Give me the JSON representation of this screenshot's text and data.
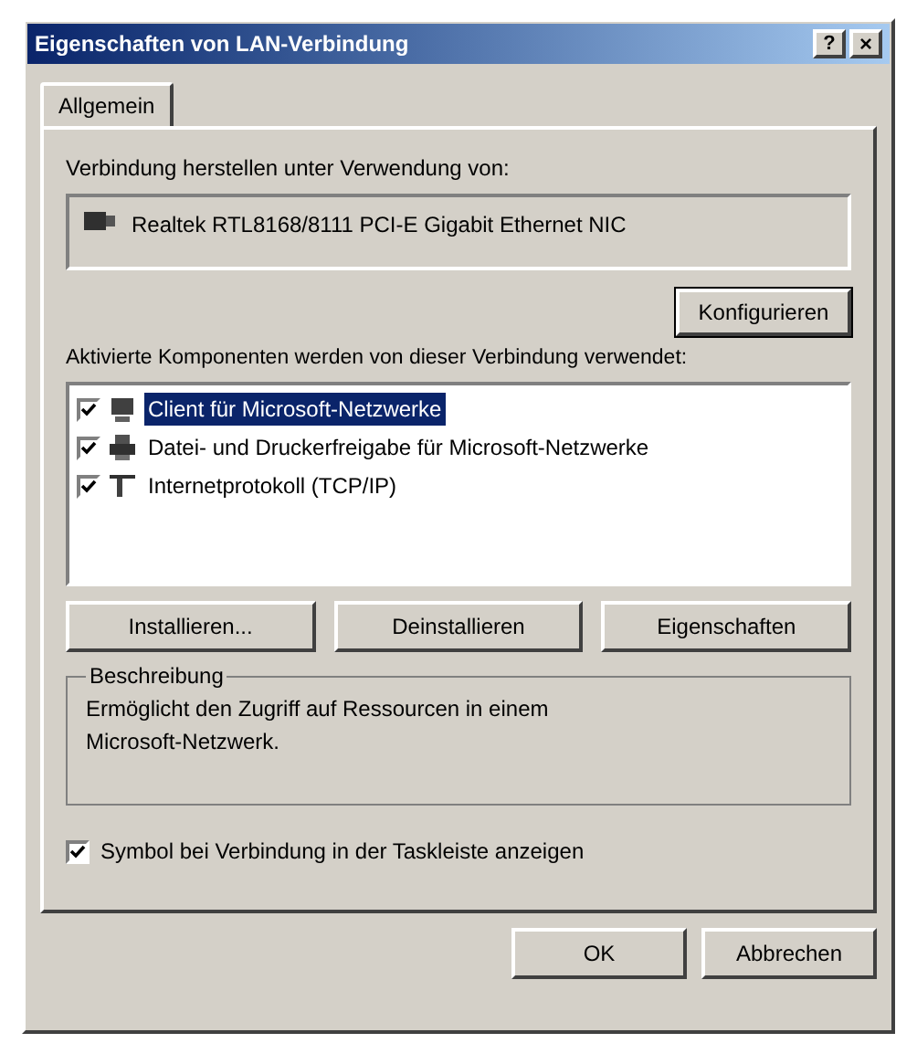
{
  "window": {
    "title": "Eigenschaften von LAN-Verbindung",
    "help_button": "?",
    "close_button": "×"
  },
  "tabs": [
    {
      "label": "Allgemein",
      "selected": true
    }
  ],
  "connect_using": {
    "label": "Verbindung herstellen unter Verwendung von:",
    "adapter": "Realtek RTL8168/8111 PCI-E Gigabit Ethernet NIC",
    "configure_button": "Konfigurieren"
  },
  "components": {
    "label": "Aktivierte Komponenten werden von dieser Verbindung verwendet:",
    "items": [
      {
        "label": "Client für Microsoft-Netzwerke",
        "checked": true,
        "selected": true,
        "kind": "client"
      },
      {
        "label": "Datei- und Druckerfreigabe für Microsoft-Netzwerke",
        "checked": true,
        "selected": false,
        "kind": "service"
      },
      {
        "label": "Internetprotokoll (TCP/IP)",
        "checked": true,
        "selected": false,
        "kind": "protocol"
      }
    ],
    "buttons": [
      "Installieren...",
      "Deinstallieren",
      "Eigenschaften"
    ]
  },
  "description": {
    "label": "Beschreibung",
    "text": "Ermöglicht den Zugriff auf Ressourcen in einem Microsoft-Netzwerk."
  },
  "show_icon": {
    "label": "Symbol bei Verbindung in der Taskleiste anzeigen",
    "checked": true
  },
  "buttons": [
    "OK",
    "Abbrechen"
  ]
}
